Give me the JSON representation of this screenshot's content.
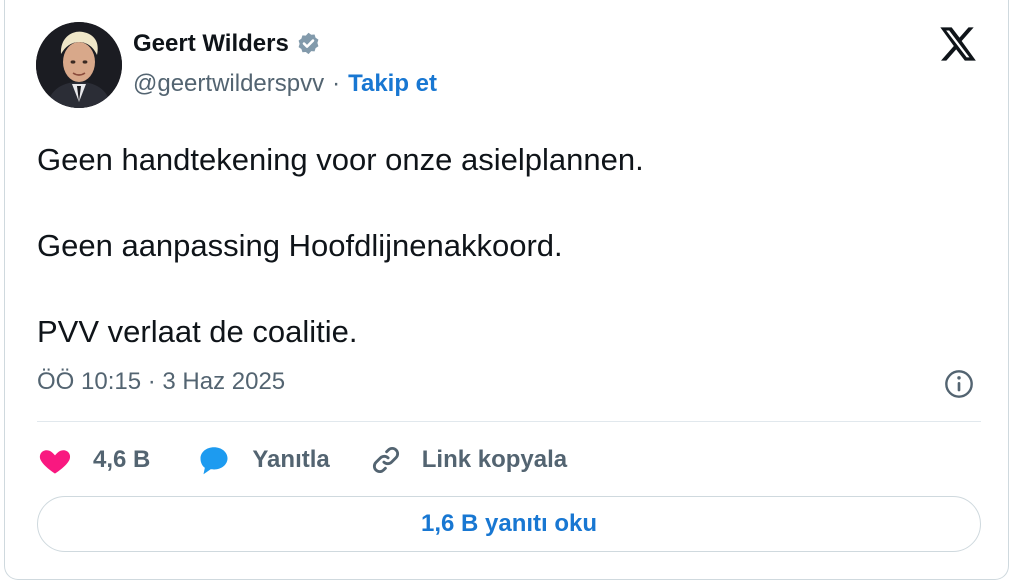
{
  "author": {
    "name": "Geert Wilders",
    "handle": "@geertwilderspvv",
    "separator": "·",
    "follow_label": "Takip et",
    "verified_badge": "verified-badge-icon",
    "avatar": "profile-photo"
  },
  "platform_logo": "x-logo-icon",
  "tweet": {
    "lines": [
      "Geen handtekening voor onze asielplannen.",
      "Geen aanpassing Hoofdlijnenakkoord.",
      "PVV verlaat de coalitie."
    ],
    "timestamp": "ÖÖ 10:15 · 3 Haz 2025"
  },
  "actions": {
    "like_count": "4,6 B",
    "like_icon": "heart-icon",
    "reply_label": "Yanıtla",
    "reply_icon": "speech-bubble-icon",
    "copy_label": "Link kopyala",
    "copy_icon": "link-icon"
  },
  "read_replies_label": "1,6 B yanıtı oku",
  "colors": {
    "accent": "#1877d2",
    "like": "#f91880",
    "reply": "#1d9bf0",
    "text": "#0f1419",
    "muted": "#536471",
    "border": "#cfd9de"
  }
}
